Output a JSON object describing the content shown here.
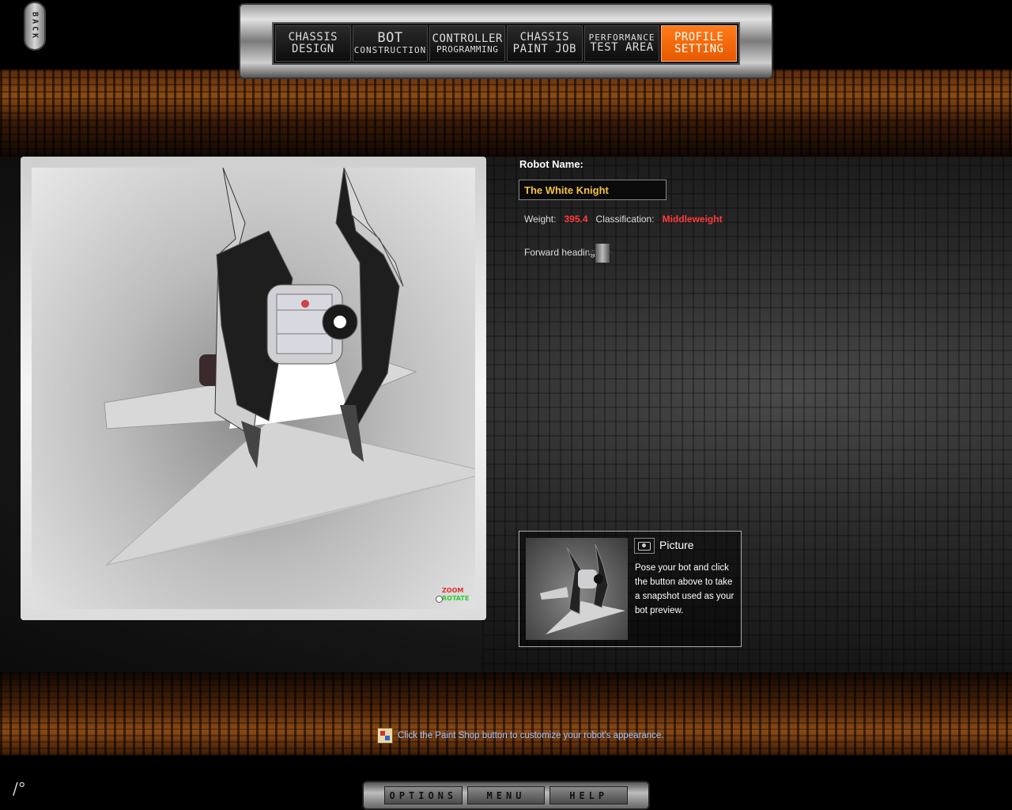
{
  "back_label": "BACK",
  "nav": [
    {
      "l1": "CHASSIS",
      "l2": "DESIGN",
      "style": "",
      "active": false
    },
    {
      "l1": "BOT",
      "l2": "CONSTRUCTION",
      "style": "small",
      "active": false
    },
    {
      "l1": "CONTROLLER",
      "l2": "PROGRAMMING",
      "style": "tiny",
      "active": false
    },
    {
      "l1": "CHASSIS",
      "l2": "PAINT JOB",
      "style": "",
      "active": false
    },
    {
      "l1": "PERFORMANCE",
      "l2": "TEST AREA",
      "style": "",
      "active": false
    },
    {
      "l1": "PROFILE",
      "l2": "SETTING",
      "style": "",
      "active": true
    }
  ],
  "viewport": {
    "zoom_label": "ZOOM",
    "rotate_label": "ROTATE"
  },
  "profile": {
    "robot_name_label": "Robot Name:",
    "robot_name_value": "The White Knight",
    "weight_label": "Weight:",
    "weight_value": "395.4",
    "class_label": "Classification:",
    "class_value": "Middleweight",
    "heading_label": "Forward heading:"
  },
  "picture": {
    "title": "Picture",
    "description": "Pose your bot and click the button above to take a snapshot used as your bot preview."
  },
  "hint": "Click the Paint Shop button to customize your robot's appearance.",
  "bottom_menu": [
    "OPTIONS",
    "MENU",
    "HELP"
  ],
  "corner_mark": "/°"
}
